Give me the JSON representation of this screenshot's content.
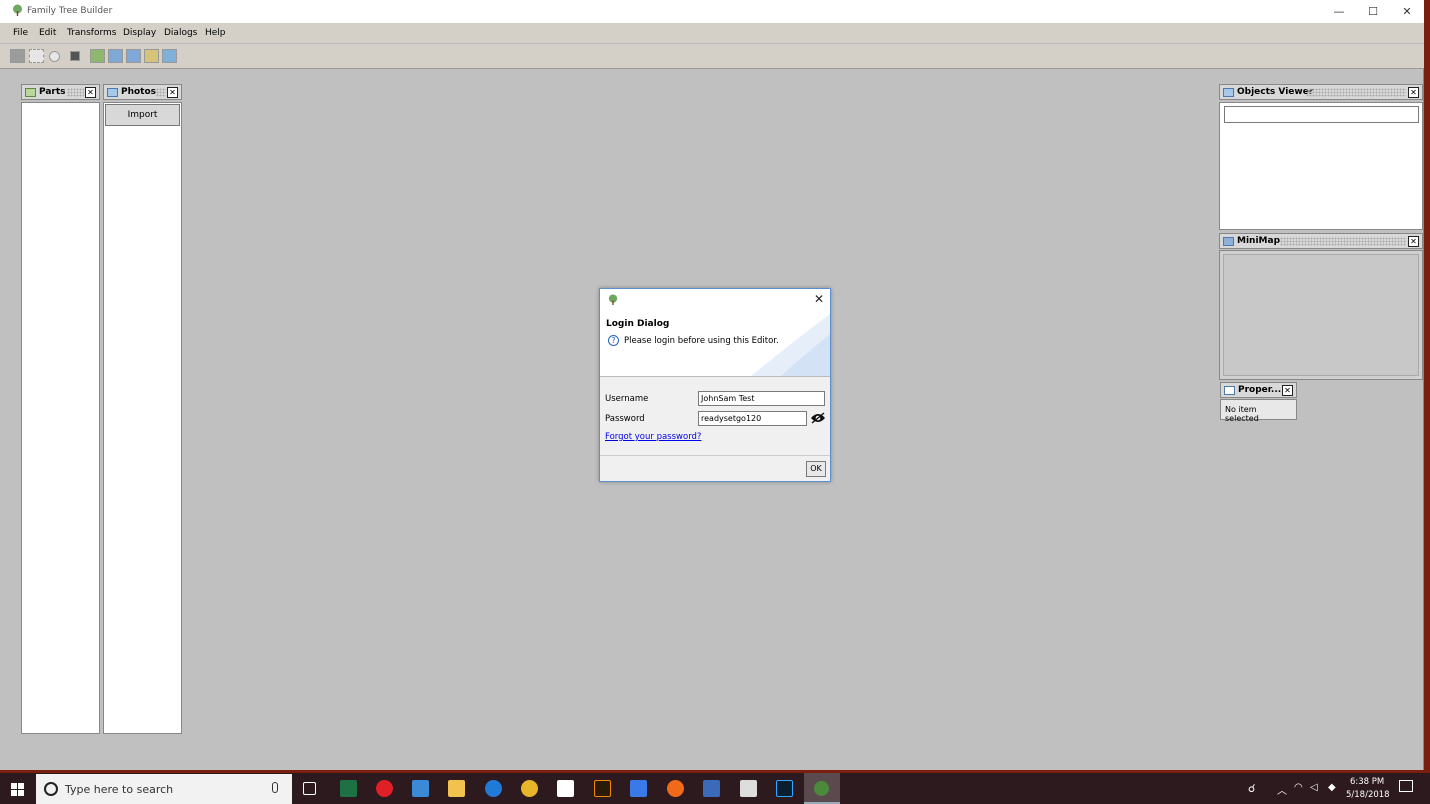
{
  "window": {
    "title": "Family Tree Builder",
    "controls": {
      "minimize": "—",
      "maximize": "☐",
      "close": "✕"
    }
  },
  "menu": {
    "items": [
      "File",
      "Edit",
      "Transforms",
      "Display",
      "Dialogs",
      "Help"
    ]
  },
  "panels": {
    "parts": {
      "title": "Parts"
    },
    "photos": {
      "title": "Photos",
      "import_label": "Import"
    },
    "objects_viewer": {
      "title": "Objects Viewer",
      "search_value": ""
    },
    "minimap": {
      "title": "MiniMap"
    },
    "properties": {
      "title": "Proper...",
      "status": "No item selected"
    }
  },
  "dialog": {
    "title": "Login Dialog",
    "message": "Please login before using this Editor.",
    "username_label": "Username",
    "username_value": "JohnSam Test",
    "password_label": "Password",
    "password_value": "readysetgo120",
    "forgot_link": "Forgot your password?",
    "ok_label": "OK"
  },
  "taskbar": {
    "search_placeholder": "Type here to search",
    "time": "6:38 PM",
    "date": "5/18/2018"
  },
  "colors": {
    "accent": "#5a8fd0",
    "link": "#0000ee",
    "taskbar": "#2c1a1e"
  }
}
